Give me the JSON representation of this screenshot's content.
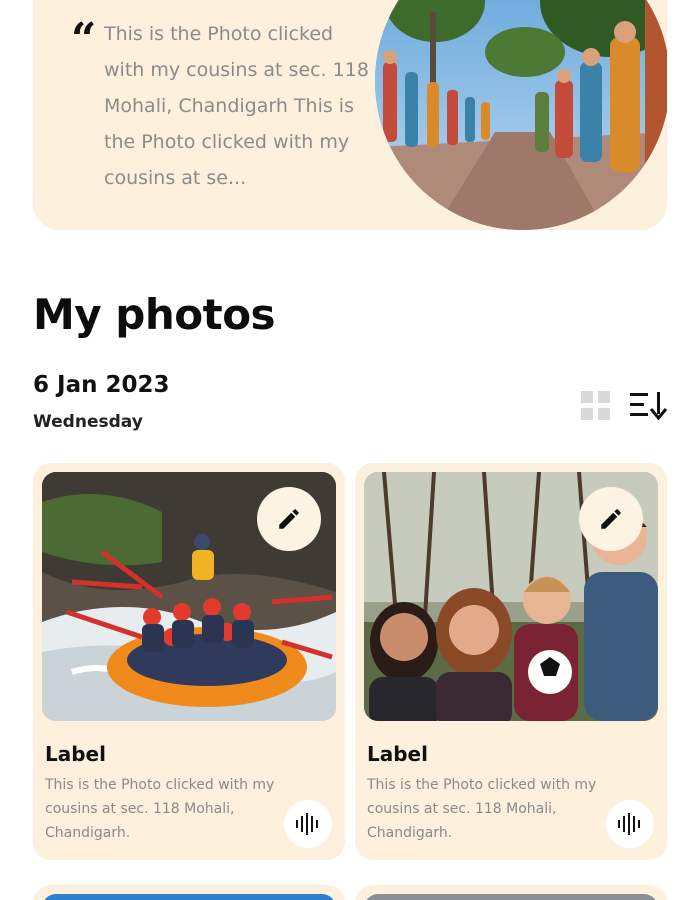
{
  "featured": {
    "quote_text": "This is the Photo clicked with my cousins at sec. 118 Mohali, Chandigarh This is the Photo clicked with my cousins at se...",
    "quote_icon": "quote-icon",
    "photo_alt": "Rock garden statues"
  },
  "section": {
    "title": "My photos",
    "date": "6 Jan 2023",
    "day": "Wednesday",
    "grid_icon": "grid-view-icon",
    "sort_icon": "sort-icon"
  },
  "cards": [
    {
      "label": "Label",
      "description": "This is the Photo clicked with my cousins at sec. 118 Mohali, Chandigarh.",
      "edit_icon": "pencil-icon",
      "audio_icon": "audio-wave-icon"
    },
    {
      "label": "Label",
      "description": "This is the Photo clicked with my cousins at sec. 118 Mohali, Chandigarh.",
      "edit_icon": "pencil-icon",
      "audio_icon": "audio-wave-icon"
    }
  ],
  "colors": {
    "card_bg": "#fdf0dc",
    "text_muted": "#8a8a8a",
    "text_dark": "#111111"
  }
}
